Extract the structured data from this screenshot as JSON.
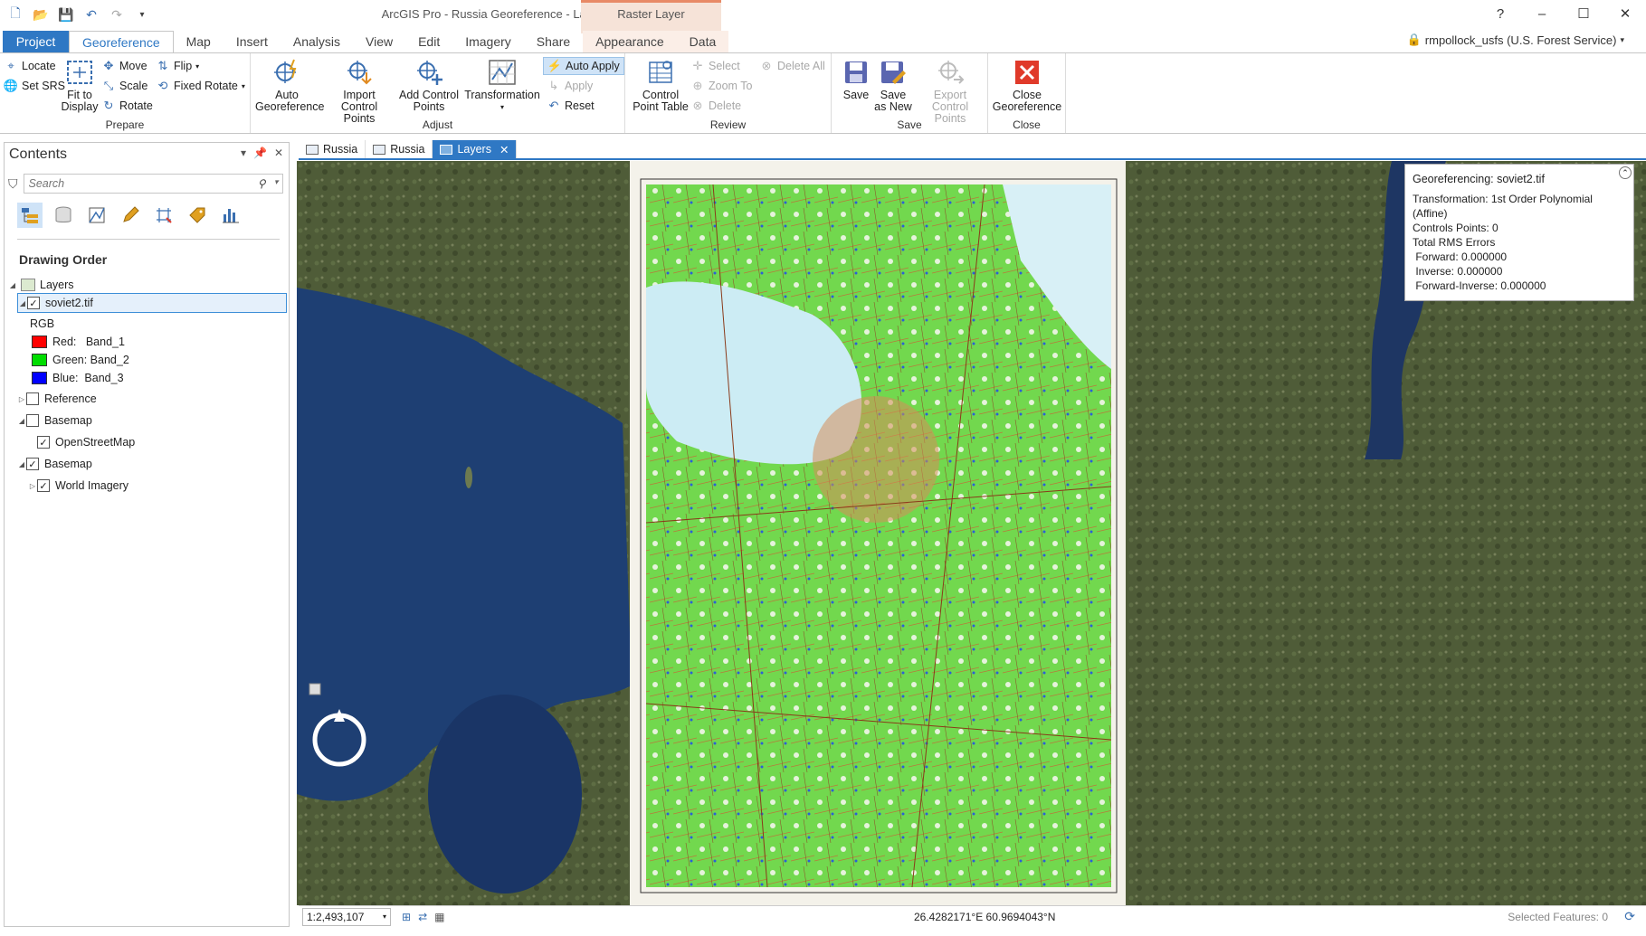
{
  "app": {
    "title": "ArcGIS Pro - Russia Georeference - Layers",
    "context_tab_group": "Raster Layer"
  },
  "window_controls": {
    "help": "?",
    "minimize": "–",
    "maximize": "☐",
    "close": "✕"
  },
  "ribbon_tabs": [
    "Project",
    "Georeference",
    "Map",
    "Insert",
    "Analysis",
    "View",
    "Edit",
    "Imagery",
    "Share",
    "Appearance",
    "Data"
  ],
  "account": {
    "name": "rmpollock_usfs (U.S. Forest Service)"
  },
  "ribbon": {
    "prepare": {
      "label": "Prepare",
      "locate": "Locate",
      "set_srs": "Set SRS",
      "fit_to_display": "Fit to Display",
      "move": "Move",
      "scale": "Scale",
      "rotate": "Rotate",
      "flip": "Flip",
      "fixed_rotate": "Fixed Rotate"
    },
    "adjust": {
      "label": "Adjust",
      "auto_georeference": "Auto Georeference",
      "import_control_points": "Import Control Points",
      "add_control_points": "Add Control Points",
      "transformation": "Transformation",
      "auto_apply": "Auto Apply",
      "apply": "Apply",
      "reset": "Reset"
    },
    "review": {
      "label": "Review",
      "control_point_table": "Control Point Table",
      "select": "Select",
      "zoom_to": "Zoom To",
      "delete": "Delete",
      "delete_all": "Delete All"
    },
    "save": {
      "label": "Save",
      "save": "Save",
      "save_as_new": "Save as New",
      "export_control_points": "Export Control Points"
    },
    "close": {
      "label": "Close",
      "close_georeference": "Close Georeference"
    }
  },
  "contents": {
    "title": "Contents",
    "search_placeholder": "Search",
    "drawing_order": "Drawing Order",
    "layers_root": "Layers",
    "soviet_layer": "soviet2.tif",
    "rgb": "RGB",
    "bands": [
      {
        "label": "Red:   Band_1",
        "color": "#ff0000"
      },
      {
        "label": "Green: Band_2",
        "color": "#00dd00"
      },
      {
        "label": "Blue:  Band_3",
        "color": "#0000ff"
      }
    ],
    "reference": "Reference",
    "basemap1": "Basemap",
    "openstreetmap": "OpenStreetMap",
    "basemap2": "Basemap",
    "world_imagery": "World Imagery"
  },
  "map_tabs": [
    "Russia",
    "Russia",
    "Layers"
  ],
  "georef_info": {
    "title": "Georeferencing: soviet2.tif",
    "transformation": "Transformation: 1st Order Polynomial (Affine)",
    "control_points": "Controls Points: 0",
    "total_rms": "Total RMS Errors",
    "forward": " Forward: 0.000000",
    "inverse": " Inverse: 0.000000",
    "forward_inverse": " Forward-Inverse: 0.000000"
  },
  "status": {
    "scale": "1:2,493,107",
    "coordinates": "26.4282171°E 60.9694043°N",
    "selected_features": "Selected Features: 0"
  },
  "colors": {
    "accent": "#2f78c4",
    "context_tab": "#f6e3d8",
    "sea": "#1e3f73",
    "land": "#4a5a36",
    "topo_green": "#6ed648"
  }
}
